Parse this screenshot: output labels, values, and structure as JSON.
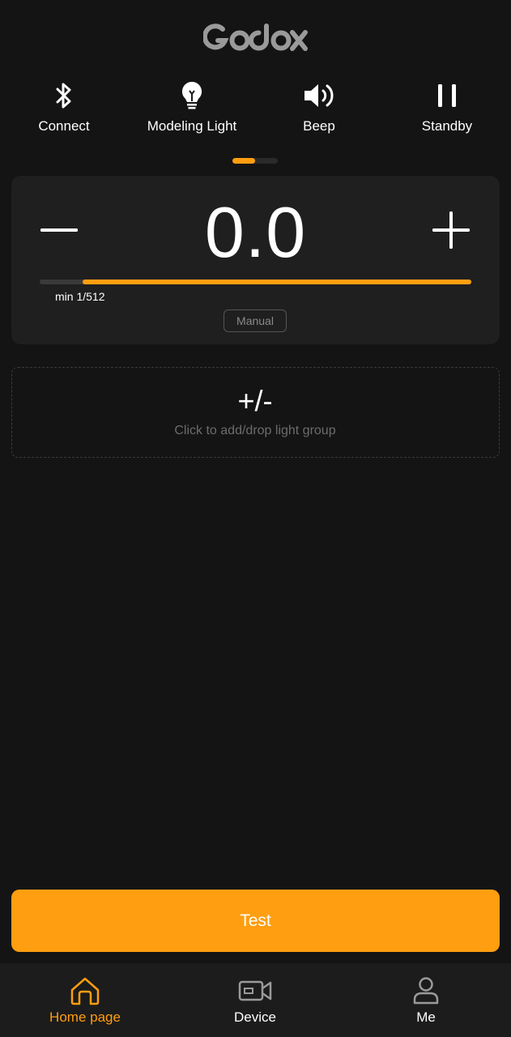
{
  "brand": {
    "logo_text": "Godox"
  },
  "quick_actions": [
    {
      "label": "Connect",
      "icon": "bluetooth-icon"
    },
    {
      "label": "Modeling Light",
      "icon": "bulb-icon"
    },
    {
      "label": "Beep",
      "icon": "speaker-icon"
    },
    {
      "label": "Standby",
      "icon": "pause-icon"
    }
  ],
  "pager": {
    "pages": 2,
    "active": 1
  },
  "power": {
    "value": "0.0",
    "min_label": "min 1/512",
    "mode": "Manual",
    "slider_fill_start": 0.1,
    "slider_fill_end": 1.0
  },
  "group": {
    "symbol": "+/-",
    "hint": "Click to add/drop light group"
  },
  "test_button": {
    "label": "Test"
  },
  "tabs": [
    {
      "label": "Home page",
      "icon": "home-icon",
      "active": true
    },
    {
      "label": "Device",
      "icon": "camera-icon",
      "active": false
    },
    {
      "label": "Me",
      "icon": "person-icon",
      "active": false
    }
  ],
  "colors": {
    "accent": "#ff9e10",
    "background": "#141414",
    "card": "#1f1f1f",
    "tabbar": "#1c1c1c",
    "muted_text": "#6c6c6c"
  }
}
